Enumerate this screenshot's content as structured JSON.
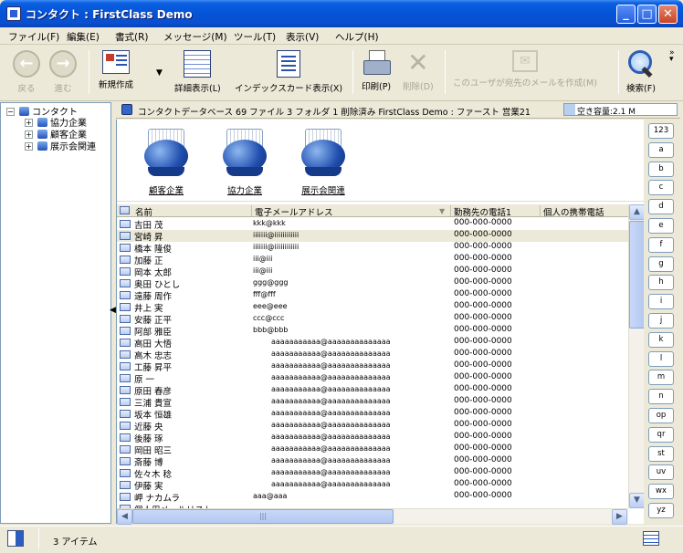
{
  "window": {
    "title": "コンタクト : FirstClass Demo",
    "controls": {
      "minimize": "_",
      "maximize": "□",
      "close": "✕"
    }
  },
  "menu": [
    "ファイル(F)",
    "編集(E)",
    "書式(R)",
    "メッセージ(M)",
    "ツール(T)",
    "表示(V)",
    "ヘルプ(H)"
  ],
  "toolbar": {
    "back": "戻る",
    "forward": "進む",
    "new": "新規作成",
    "detail_view": "詳細表示(L)",
    "index_card_view": "インデックスカード表示(X)",
    "print": "印刷(P)",
    "delete": "削除(D)",
    "compose_to_user": "このユーザが宛先のメールを作成(M)",
    "search": "検索(F)"
  },
  "tree": {
    "root": "コンタクト",
    "children": [
      "協力企業",
      "顧客企業",
      "展示会関連"
    ]
  },
  "info": {
    "text": "コンタクトデータベース  69 ファイル  3 フォルダ  1 削除済み   FirstClass Demo : ファースト 営業21",
    "capacity_label": "空き容量:2.1 M",
    "capacity_used": 0.1
  },
  "folders": [
    "顧客企業",
    "協力企業",
    "展示会関連"
  ],
  "columns": {
    "name": "名前",
    "email": "電子メールアドレス",
    "work_phone": "勤務先の電話1",
    "mobile": "個人の携帯電話"
  },
  "contacts": [
    {
      "name": "吉田 茂",
      "email": "kkk@kkk",
      "phone": "000-000-0000"
    },
    {
      "name": "宮崎 昇",
      "email": "iiiiiii@iiiiiiiiiiii",
      "phone": "000-000-0000"
    },
    {
      "name": "橋本 隆俊",
      "email": "iiiiiii@iiiiiiiiiiii",
      "phone": "000-000-0000"
    },
    {
      "name": "加藤 正",
      "email": "iii@iii",
      "phone": "000-000-0000"
    },
    {
      "name": "岡本 太郎",
      "email": "iii@iii",
      "phone": "000-000-0000"
    },
    {
      "name": "奥田 ひとし",
      "email": "ggg@ggg",
      "phone": "000-000-0000"
    },
    {
      "name": "遠藤 周作",
      "email": "fff@fff",
      "phone": "000-000-0000"
    },
    {
      "name": "井上 実",
      "email": "eee@eee",
      "phone": "000-000-0000"
    },
    {
      "name": "安藤 正平",
      "email": "ccc@ccc",
      "phone": "000-000-0000"
    },
    {
      "name": "阿部 雅臣",
      "email": "bbb@bbb",
      "phone": "000-000-0000"
    },
    {
      "name": "高田 大悟",
      "email": "aaaaaaaaaaa@aaaaaaaaaaaaaa",
      "phone": "000-000-0000"
    },
    {
      "name": "高木 忠志",
      "email": "aaaaaaaaaaa@aaaaaaaaaaaaaa",
      "phone": "000-000-0000"
    },
    {
      "name": "工藤 昇平",
      "email": "aaaaaaaaaaa@aaaaaaaaaaaaaa",
      "phone": "000-000-0000"
    },
    {
      "name": "原 一",
      "email": "aaaaaaaaaaa@aaaaaaaaaaaaaa",
      "phone": "000-000-0000"
    },
    {
      "name": "原田 春彦",
      "email": "aaaaaaaaaaa@aaaaaaaaaaaaaa",
      "phone": "000-000-0000"
    },
    {
      "name": "三浦 貴宣",
      "email": "aaaaaaaaaaa@aaaaaaaaaaaaaa",
      "phone": "000-000-0000"
    },
    {
      "name": "坂本 恒雄",
      "email": "aaaaaaaaaaa@aaaaaaaaaaaaaa",
      "phone": "000-000-0000"
    },
    {
      "name": "近藤 央",
      "email": "aaaaaaaaaaa@aaaaaaaaaaaaaa",
      "phone": "000-000-0000"
    },
    {
      "name": "後藤 琢",
      "email": "aaaaaaaaaaa@aaaaaaaaaaaaaa",
      "phone": "000-000-0000"
    },
    {
      "name": "岡田 昭三",
      "email": "aaaaaaaaaaa@aaaaaaaaaaaaaa",
      "phone": "000-000-0000"
    },
    {
      "name": "斎藤 博",
      "email": "aaaaaaaaaaa@aaaaaaaaaaaaaa",
      "phone": "000-000-0000"
    },
    {
      "name": "佐々木 稔",
      "email": "aaaaaaaaaaa@aaaaaaaaaaaaaa",
      "phone": "000-000-0000"
    },
    {
      "name": "伊藤 実",
      "email": "aaaaaaaaaaa@aaaaaaaaaaaaaa",
      "phone": "000-000-0000"
    },
    {
      "name": "岬 ナカムラ",
      "email": "aaa@aaa",
      "phone": "000-000-0000"
    },
    {
      "name": "個人用メールリスト",
      "email": "",
      "phone": ""
    }
  ],
  "alphabet": [
    "123",
    "a",
    "b",
    "c",
    "d",
    "e",
    "f",
    "g",
    "h",
    "i",
    "j",
    "k",
    "l",
    "m",
    "n",
    "op",
    "qr",
    "st",
    "uv",
    "wx",
    "yz"
  ],
  "status": {
    "text": "3 アイテム"
  }
}
